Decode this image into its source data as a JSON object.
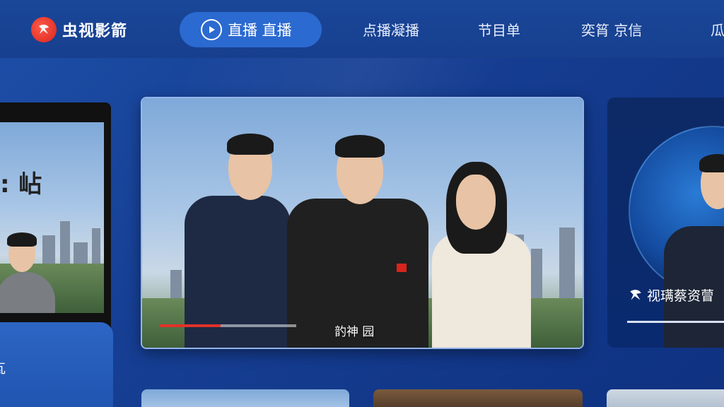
{
  "app": {
    "logo_text": "虫视影箭",
    "logo_icon": "cctv-logo-icon"
  },
  "nav": {
    "live_label": "直播 直播",
    "live_icon": "play-icon",
    "items": [
      {
        "label": "点播凝播"
      },
      {
        "label": "节目单"
      },
      {
        "label": "奕筲 京信"
      },
      {
        "label": "瓜"
      }
    ]
  },
  "main_card": {
    "caption": "䪨神 园",
    "progress_fraction": 0.45,
    "progress_color": "#e0322a"
  },
  "left_card": {
    "headline": ": 岾",
    "panel_text": "瓦"
  },
  "right_card": {
    "caption": "视𫞩蔡资萺",
    "logo_icon": "cctv-logo-icon"
  },
  "colors": {
    "background": "#163f94",
    "accent": "#2b6ad0",
    "brand_red": "#d7241c"
  }
}
